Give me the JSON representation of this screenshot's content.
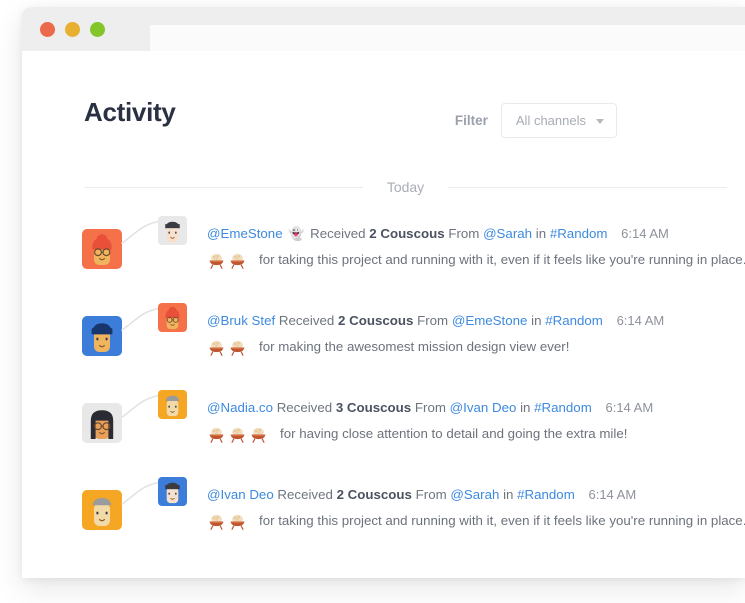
{
  "window": {
    "traffic_lights": [
      {
        "name": "close",
        "color": "#ec6a4c"
      },
      {
        "name": "minimize",
        "color": "#e8b030"
      },
      {
        "name": "maximize",
        "color": "#84c52a"
      }
    ],
    "address_value": ""
  },
  "header": {
    "title": "Activity",
    "filter_label": "Filter",
    "filter_value": "All channels",
    "filter_options": [
      "All channels"
    ],
    "caret_icon": "chevron-down-icon"
  },
  "divider": {
    "label": "Today"
  },
  "colors": {
    "mention": "#3d8ae0",
    "text": "#6c727c",
    "title": "#2a3142",
    "muted": "#a9aeb5",
    "border": "#e9eaec",
    "titlebar": "#efeeee"
  },
  "activities": [
    {
      "recipient": "@EmeStone",
      "recipient_emoji": "👻",
      "received_label": "Received",
      "amount": "2 Couscous",
      "from_label": "From",
      "sender": "@Sarah",
      "in_label": "in",
      "channel": "#Random",
      "time": "6:14 AM",
      "message": "for taking this project and running with it, even if it feels like you're running in place.",
      "emoji_count": 2,
      "avatar_large": {
        "name": "avatar-emestone",
        "bg": "#f4714a",
        "hair": "#e8503a",
        "skin": "#f0b45e",
        "hair_style": "bun",
        "glasses": true
      },
      "avatar_small": {
        "name": "avatar-sarah",
        "bg": "#e8e8e8",
        "hair": "#3a3a42",
        "skin": "#f6e0cd",
        "hair_style": "bob",
        "glasses": false
      }
    },
    {
      "recipient": "@Bruk Stef",
      "recipient_emoji": "",
      "received_label": "Received",
      "amount": "2 Couscous",
      "from_label": "From",
      "sender": "@EmeStone",
      "in_label": "in",
      "channel": "#Random",
      "time": "6:14 AM",
      "message": "for making the awesomest mission design view ever!",
      "emoji_count": 2,
      "avatar_large": {
        "name": "avatar-brukstef",
        "bg": "#3b7dd8",
        "hair": "#17366d",
        "skin": "#f0b45e",
        "hair_style": "bowl",
        "glasses": false
      },
      "avatar_small": {
        "name": "avatar-emestone",
        "bg": "#f4714a",
        "hair": "#e8503a",
        "skin": "#f0b45e",
        "hair_style": "bun",
        "glasses": true
      }
    },
    {
      "recipient": "@Nadia.co",
      "recipient_emoji": "",
      "received_label": "Received",
      "amount": "3 Couscous",
      "from_label": "From",
      "sender": "@Ivan Deo",
      "in_label": "in",
      "channel": "#Random",
      "time": "6:14 AM",
      "message": "for having close attention to detail and going the extra mile!",
      "emoji_count": 3,
      "avatar_large": {
        "name": "avatar-nadia",
        "bg": "#e8e8e8",
        "hair": "#2b2b33",
        "skin": "#e8a05a",
        "hair_style": "long",
        "glasses": true
      },
      "avatar_small": {
        "name": "avatar-ivandeo",
        "bg": "#f5a623",
        "hair": "#9b9b9b",
        "skin": "#f2d9a8",
        "hair_style": "short",
        "glasses": false
      }
    },
    {
      "recipient": "@Ivan Deo",
      "recipient_emoji": "",
      "received_label": "Received",
      "amount": "2 Couscous",
      "from_label": "From",
      "sender": "@Sarah",
      "in_label": "in",
      "channel": "#Random",
      "time": "6:14 AM",
      "message": "for taking this project and running with it, even if it feels like you're running in place.",
      "emoji_count": 2,
      "avatar_large": {
        "name": "avatar-ivandeo",
        "bg": "#f5a623",
        "hair": "#9b9b9b",
        "skin": "#f2d9a8",
        "hair_style": "short",
        "glasses": false
      },
      "avatar_small": {
        "name": "avatar-sarah",
        "bg": "#3b7dd8",
        "hair": "#3a3a42",
        "skin": "#f6e0cd",
        "hair_style": "bob",
        "glasses": false
      }
    }
  ]
}
